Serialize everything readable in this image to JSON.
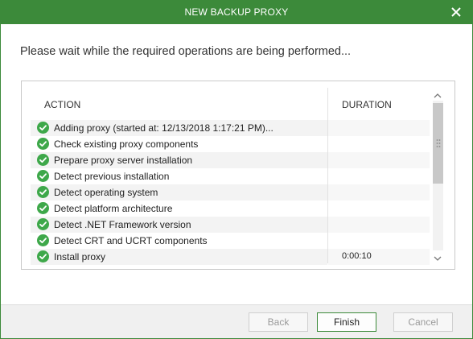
{
  "window": {
    "title": "NEW BACKUP PROXY"
  },
  "main": {
    "subtitle": "Please wait while the required operations are being performed..."
  },
  "table": {
    "columns": [
      "ACTION",
      "DURATION"
    ],
    "rows": [
      {
        "action": "Adding proxy (started at: 12/13/2018 1:17:21 PM)...",
        "duration": "",
        "status": "success"
      },
      {
        "action": "Check existing proxy components",
        "duration": "",
        "status": "success"
      },
      {
        "action": "Prepare proxy server installation",
        "duration": "",
        "status": "success"
      },
      {
        "action": "Detect previous installation",
        "duration": "",
        "status": "success"
      },
      {
        "action": "Detect operating system",
        "duration": "",
        "status": "success"
      },
      {
        "action": "Detect platform architecture",
        "duration": "",
        "status": "success"
      },
      {
        "action": "Detect .NET Framework version",
        "duration": "",
        "status": "success"
      },
      {
        "action": "Detect CRT and UCRT components",
        "duration": "",
        "status": "success"
      },
      {
        "action": "Install proxy",
        "duration": "0:00:10",
        "status": "success"
      }
    ]
  },
  "footer": {
    "back_label": "Back",
    "finish_label": "Finish",
    "cancel_label": "Cancel"
  },
  "colors": {
    "accent": "#3c8a3a",
    "success": "#3ea84a"
  },
  "icons": {
    "close": "close-icon",
    "status": "check-circle-icon",
    "scroll_up": "chevron-up-icon",
    "scroll_down": "chevron-down-icon"
  }
}
